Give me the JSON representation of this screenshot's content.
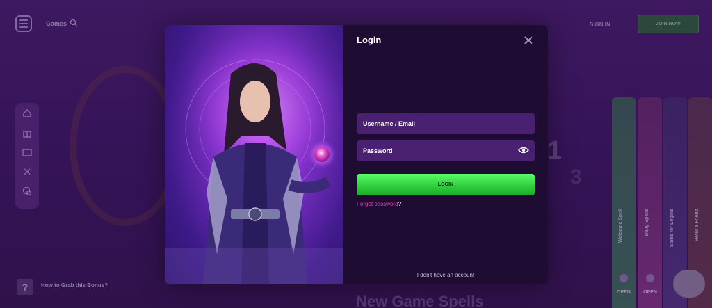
{
  "header": {
    "games_label": "Games",
    "sign_in_label": "SIGN IN",
    "join_label": "JOIN NOW"
  },
  "background": {
    "help_glyph": "?",
    "help_text": "How to Grab this Bonus?",
    "step_1": "1",
    "step_3": "3",
    "section_title": "New Game Spells",
    "spells": [
      {
        "label": "Welcome Spell",
        "open": "OPEN"
      },
      {
        "label": "Daily Spells",
        "open": "OPEN"
      },
      {
        "label": "Spins for Logins",
        "open": ""
      },
      {
        "label": "Refer a Friend",
        "open": ""
      }
    ]
  },
  "modal": {
    "title": "Login",
    "username_placeholder": "Username / Email",
    "password_placeholder": "Password",
    "login_label": "LOGIN",
    "forgot_label": "Forgot password",
    "forgot_q": "?",
    "no_account": "I don't have an account"
  },
  "colors": {
    "accent_green": "#2fd13c",
    "link_pink": "#e040c0",
    "form_bg": "#1f0c33",
    "field_bg": "#4a2070"
  },
  "icons": [
    "menu-icon",
    "search-icon",
    "home-icon",
    "gift-icon",
    "wallet-icon",
    "compass-icon",
    "chat-icon",
    "help-icon",
    "close-icon",
    "eye-icon",
    "wizard-illustration"
  ]
}
